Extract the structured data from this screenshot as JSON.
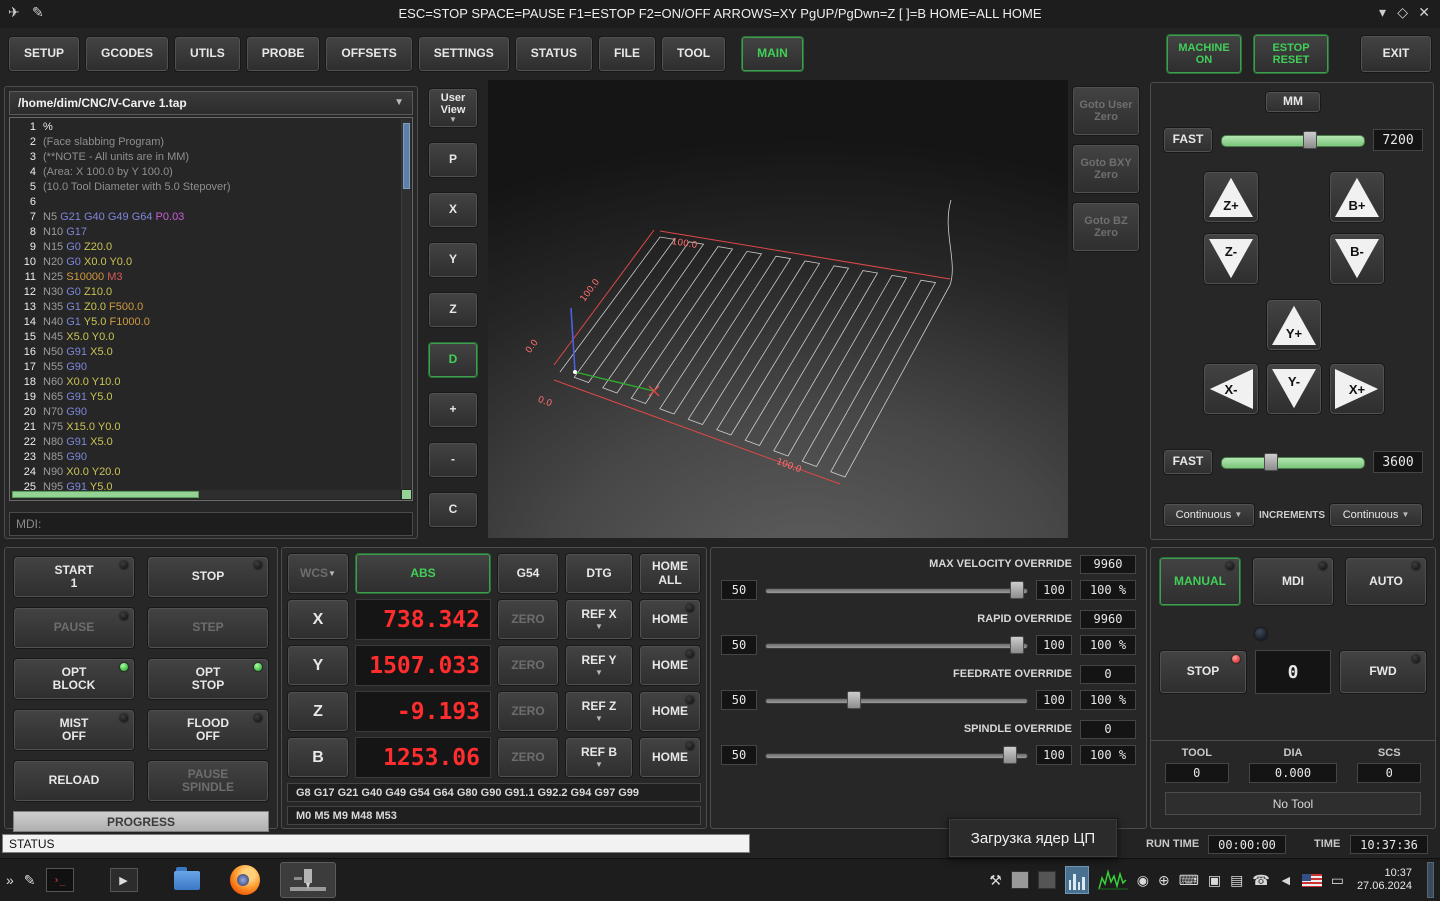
{
  "titlebar": {
    "title": "ESC=STOP SPACE=PAUSE F1=ESTOP F2=ON/OFF ARROWS=XY PgUP/PgDwn=Z [ ]=B HOME=ALL HOME"
  },
  "tabs": {
    "items": [
      "SETUP",
      "GCODES",
      "UTILS",
      "PROBE",
      "OFFSETS",
      "SETTINGS",
      "STATUS",
      "FILE",
      "TOOL",
      "MAIN"
    ],
    "active": "MAIN",
    "machine_on": "MACHINE\nON",
    "estop_reset": "ESTOP\nRESET",
    "exit": "EXIT"
  },
  "gcode": {
    "path": "/home/dim/CNC/V-Carve 1.tap",
    "mdi_label": "MDI:",
    "lines": [
      "%",
      "(Face slabbing Program)",
      "(**NOTE - All units are in MM)",
      "(Area: X 100.0 by Y 100.0)",
      "(10.0 Tool Diameter with 5.0 Stepover)",
      "",
      "N5 G21 G40 G49 G64 P0.03",
      "N10 G17",
      "N15 G0 Z20.0",
      "N20 G0 X0.0 Y0.0",
      "N25 S10000 M3",
      "N30 G0 Z10.0",
      "N35 G1 Z0.0 F500.0",
      "N40 G1 Y5.0 F1000.0",
      "N45 X5.0 Y0.0",
      "N50 G91 X5.0",
      "N55 G90",
      "N60 X0.0 Y10.0",
      "N65 G91 Y5.0",
      "N70 G90",
      "N75 X15.0 Y0.0",
      "N80 G91 X5.0",
      "N85 G90",
      "N90 X0.0 Y20.0",
      "N95 G91 Y5.0"
    ]
  },
  "view": {
    "user_view": "User\nView",
    "buttons": [
      "P",
      "X",
      "Y",
      "Z",
      "D",
      "+",
      "-",
      "C"
    ],
    "active": "D"
  },
  "goto_buttons": [
    "Goto User Zero",
    "Goto BXY Zero",
    "Goto BZ Zero"
  ],
  "preview": {
    "dim_top": "100.0",
    "dim_left": "100.0",
    "dim_bottom": "100.0",
    "zero_1": "0.0",
    "zero_2": "0.0"
  },
  "jog": {
    "units": "MM",
    "fast_top": {
      "label": "FAST",
      "value": "7200",
      "slider": 62
    },
    "fast_bottom": {
      "label": "FAST",
      "value": "3600",
      "slider": 35
    },
    "buttons": [
      {
        "label": "Z+",
        "dir": "up"
      },
      {
        "label": "B+",
        "dir": "up"
      },
      {
        "label": "Z-",
        "dir": "down"
      },
      {
        "label": "B-",
        "dir": "down"
      },
      {
        "label": "Y+",
        "dir": "up"
      },
      {
        "label": "X-",
        "dir": "left"
      },
      {
        "label": "Y-",
        "dir": "down"
      },
      {
        "label": "X+",
        "dir": "right"
      }
    ],
    "continuous_left": "Continuous",
    "increments_label": "INCREMENTS",
    "continuous_right": "Continuous"
  },
  "machine": {
    "buttons": [
      {
        "label": "START\n1",
        "led": "off"
      },
      {
        "label": "STOP",
        "led": "off"
      },
      {
        "label": "PAUSE",
        "led": "off",
        "disabled": true
      },
      {
        "label": "STEP",
        "disabled": true
      },
      {
        "label": "OPT\nBLOCK",
        "led": "green"
      },
      {
        "label": "OPT\nSTOP",
        "led": "green"
      },
      {
        "label": "MIST\nOFF",
        "led": "off"
      },
      {
        "label": "FLOOD\nOFF",
        "led": "off"
      },
      {
        "label": "RELOAD"
      },
      {
        "label": "PAUSE\nSPINDLE",
        "disabled": true
      }
    ],
    "progress_label": "PROGRESS"
  },
  "dro": {
    "header": {
      "wcs": "WCS",
      "abs": "ABS",
      "g54": "G54",
      "dtg": "DTG",
      "home_all": "HOME ALL"
    },
    "zero_label": "ZERO",
    "home_label": "HOME",
    "axes": [
      {
        "axis": "X",
        "value": "738.342",
        "ref": "REF X"
      },
      {
        "axis": "Y",
        "value": "1507.033",
        "ref": "REF Y"
      },
      {
        "axis": "Z",
        "value": "-9.193",
        "ref": "REF Z"
      },
      {
        "axis": "B",
        "value": "1253.06",
        "ref": "REF B"
      }
    ],
    "gcodes_line": "G8 G17 G21 G40 G49 G54 G64 G80 G90 G91.1 G92.2 G94 G97 G99",
    "mcodes_line": "M0 M5 M9 M48 M53"
  },
  "overrides": [
    {
      "label": "MAX VELOCITY OVERRIDE",
      "value": "9960",
      "min": "50",
      "max": "100",
      "percent": "100 %",
      "slider": 96
    },
    {
      "label": "RAPID OVERRIDE",
      "value": "9960",
      "min": "50",
      "max": "100",
      "percent": "100 %",
      "slider": 96
    },
    {
      "label": "FEEDRATE OVERRIDE",
      "value": "0",
      "min": "50",
      "max": "100",
      "percent": "100 %",
      "slider": 34
    },
    {
      "label": "SPINDLE OVERRIDE",
      "value": "0",
      "min": "50",
      "max": "100",
      "percent": "100 %",
      "slider": 93
    }
  ],
  "modes": {
    "items": [
      {
        "label": "MANUAL",
        "active": true,
        "led": "off"
      },
      {
        "label": "MDI",
        "led": "off"
      },
      {
        "label": "AUTO",
        "led": "off"
      }
    ],
    "spindle": {
      "stop": "STOP",
      "value": "0",
      "fwd": "FWD"
    },
    "tool": {
      "headers": [
        "TOOL",
        "DIA",
        "SCS"
      ],
      "values": [
        "0",
        "0.000",
        "0"
      ],
      "status": "No Tool"
    }
  },
  "statusbar": {
    "status": "STATUS",
    "run_time_label": "RUN TIME",
    "run_time": "00:00:00",
    "time_label": "TIME",
    "time": "10:37:36"
  },
  "taskbar": {
    "tooltip": "Загрузка ядер ЦП",
    "clock_time": "10:37",
    "clock_date": "27.06.2024",
    "left_icons": [
      {
        "name": "chevrons-icon",
        "kind": "glyph",
        "glyph": "»"
      },
      {
        "name": "pin-icon",
        "kind": "glyph",
        "glyph": "✎"
      },
      {
        "name": "terminal-app-icon",
        "kind": "terminal",
        "glyph": "›_"
      },
      {
        "name": "run-app-icon",
        "kind": "run",
        "glyph": "▶"
      },
      {
        "name": "file-manager-icon",
        "kind": "folder"
      },
      {
        "name": "firefox-icon",
        "kind": "firefox"
      },
      {
        "name": "cnc-app-icon",
        "kind": "cnc",
        "active": true
      }
    ],
    "tray_icons": [
      {
        "name": "mill-tool-icon",
        "kind": "glyph",
        "glyph": "⚒"
      },
      {
        "name": "workspace-1-icon",
        "kind": "ws",
        "tone": "#9a9a9a"
      },
      {
        "name": "workspace-2-icon",
        "kind": "ws",
        "tone": "#555555"
      },
      {
        "name": "cpu-load-icon",
        "kind": "cpu",
        "active": true
      },
      {
        "name": "network-graph-icon",
        "kind": "graph"
      },
      {
        "name": "bell-icon",
        "kind": "glyph",
        "glyph": "◉"
      },
      {
        "name": "updates-icon",
        "kind": "glyph",
        "glyph": "⊕"
      },
      {
        "name": "keyboard-icon",
        "kind": "glyph",
        "glyph": "⌨"
      },
      {
        "name": "remote-icon",
        "kind": "glyph",
        "glyph": "▣"
      },
      {
        "name": "clipboard-icon",
        "kind": "glyph",
        "glyph": "▤"
      },
      {
        "name": "phone-icon",
        "kind": "glyph",
        "glyph": "☎"
      },
      {
        "name": "volume-icon",
        "kind": "glyph",
        "glyph": "◄"
      },
      {
        "name": "keyboard-layout-flag",
        "kind": "flag"
      },
      {
        "name": "display-icon",
        "kind": "glyph",
        "glyph": "▭"
      }
    ]
  }
}
